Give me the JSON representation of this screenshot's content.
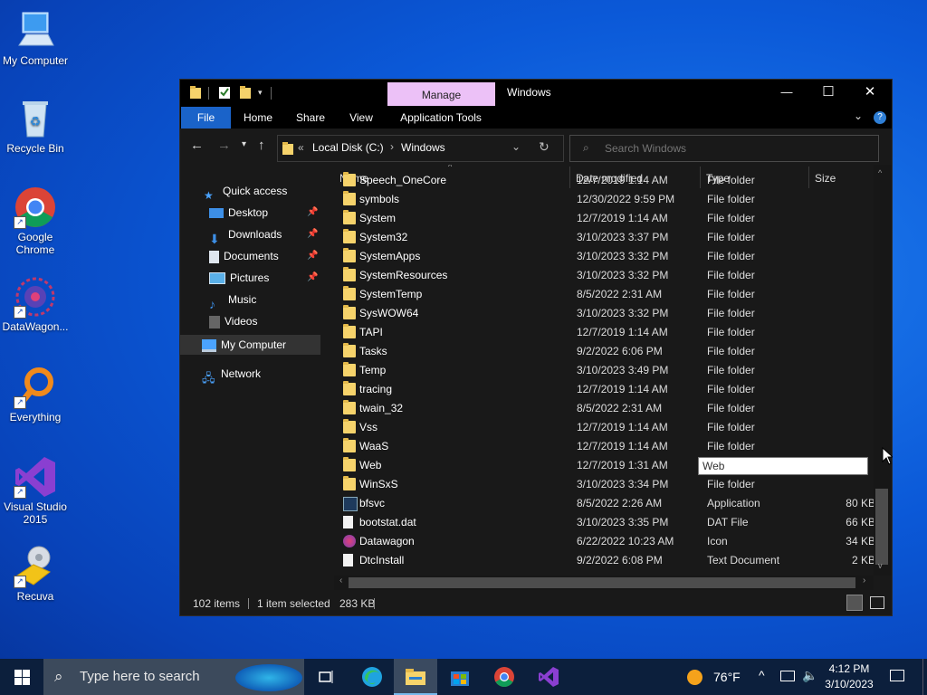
{
  "desktop": {
    "icons": [
      {
        "label": "My Computer",
        "icon": "computer-icon"
      },
      {
        "label": "Recycle Bin",
        "icon": "recycle-bin-icon"
      },
      {
        "label": "Google Chrome",
        "icon": "chrome-icon"
      },
      {
        "label": "DataWagon...",
        "icon": "datawagon-icon"
      },
      {
        "label": "Everything",
        "icon": "everything-search-icon"
      },
      {
        "label": "Visual Studio 2015",
        "icon": "visual-studio-icon"
      },
      {
        "label": "Recuva",
        "icon": "recuva-icon"
      }
    ]
  },
  "window": {
    "title": "Windows",
    "manage_tab": "Manage",
    "controls": {
      "minimize": "—",
      "maximize": "☐",
      "close": "✕"
    },
    "ribbon_tabs": [
      "File",
      "Home",
      "Share",
      "View",
      "Application Tools"
    ],
    "address": {
      "overflow": "«",
      "segments": [
        "Local Disk (C:)",
        "Windows"
      ]
    },
    "search": {
      "placeholder": "Search Windows"
    },
    "accent": "#1a63c9",
    "manage_color": "#ecc1f7"
  },
  "nav_pane": {
    "quick_access": "Quick access",
    "quick_items": [
      "Desktop",
      "Downloads",
      "Documents",
      "Pictures",
      "Music",
      "Videos"
    ],
    "my_computer": "My Computer",
    "network": "Network"
  },
  "columns": {
    "name": "Name",
    "date": "Date modified",
    "type": "Type",
    "size": "Size"
  },
  "files": [
    {
      "name": "Speech_OneCore",
      "date": "12/7/2019 1:14 AM",
      "type": "File folder",
      "size": "",
      "kind": "folder"
    },
    {
      "name": "symbols",
      "date": "12/30/2022 9:59 PM",
      "type": "File folder",
      "size": "",
      "kind": "folder"
    },
    {
      "name": "System",
      "date": "12/7/2019 1:14 AM",
      "type": "File folder",
      "size": "",
      "kind": "folder"
    },
    {
      "name": "System32",
      "date": "3/10/2023 3:37 PM",
      "type": "File folder",
      "size": "",
      "kind": "folder"
    },
    {
      "name": "SystemApps",
      "date": "3/10/2023 3:32 PM",
      "type": "File folder",
      "size": "",
      "kind": "folder"
    },
    {
      "name": "SystemResources",
      "date": "3/10/2023 3:32 PM",
      "type": "File folder",
      "size": "",
      "kind": "folder"
    },
    {
      "name": "SystemTemp",
      "date": "8/5/2022 2:31 AM",
      "type": "File folder",
      "size": "",
      "kind": "folder"
    },
    {
      "name": "SysWOW64",
      "date": "3/10/2023 3:32 PM",
      "type": "File folder",
      "size": "",
      "kind": "folder"
    },
    {
      "name": "TAPI",
      "date": "12/7/2019 1:14 AM",
      "type": "File folder",
      "size": "",
      "kind": "folder"
    },
    {
      "name": "Tasks",
      "date": "9/2/2022 6:06 PM",
      "type": "File folder",
      "size": "",
      "kind": "folder"
    },
    {
      "name": "Temp",
      "date": "3/10/2023 3:49 PM",
      "type": "File folder",
      "size": "",
      "kind": "folder"
    },
    {
      "name": "tracing",
      "date": "12/7/2019 1:14 AM",
      "type": "File folder",
      "size": "",
      "kind": "folder"
    },
    {
      "name": "twain_32",
      "date": "8/5/2022 2:31 AM",
      "type": "File folder",
      "size": "",
      "kind": "folder"
    },
    {
      "name": "Vss",
      "date": "12/7/2019 1:14 AM",
      "type": "File folder",
      "size": "",
      "kind": "folder"
    },
    {
      "name": "WaaS",
      "date": "12/7/2019 1:14 AM",
      "type": "File folder",
      "size": "",
      "kind": "folder"
    },
    {
      "name": "Web",
      "date": "12/7/2019 1:31 AM",
      "type": "Web",
      "size": "",
      "kind": "folder",
      "tooltip": true
    },
    {
      "name": "WinSxS",
      "date": "3/10/2023 3:34 PM",
      "type": "File folder",
      "size": "",
      "kind": "folder"
    },
    {
      "name": "bfsvc",
      "date": "8/5/2022 2:26 AM",
      "type": "Application",
      "size": "80 KB",
      "kind": "app"
    },
    {
      "name": "bootstat.dat",
      "date": "3/10/2023 3:35 PM",
      "type": "DAT File",
      "size": "66 KB",
      "kind": "file"
    },
    {
      "name": "Datawagon",
      "date": "6/22/2022 10:23 AM",
      "type": "Icon",
      "size": "34 KB",
      "kind": "icon"
    },
    {
      "name": "DtcInstall",
      "date": "9/2/2022 6:08 PM",
      "type": "Text Document",
      "size": "2 KB",
      "kind": "text"
    }
  ],
  "status": {
    "count": "102 items",
    "selected": "1 item selected",
    "size": "283 KB"
  },
  "taskbar": {
    "search_placeholder": "Type here to search",
    "weather": "76°F",
    "time": "4:12 PM",
    "date": "3/10/2023",
    "apps": [
      "task-view-icon",
      "edge-icon",
      "file-explorer-icon",
      "store-icon",
      "chrome-icon",
      "visual-studio-icon"
    ]
  }
}
